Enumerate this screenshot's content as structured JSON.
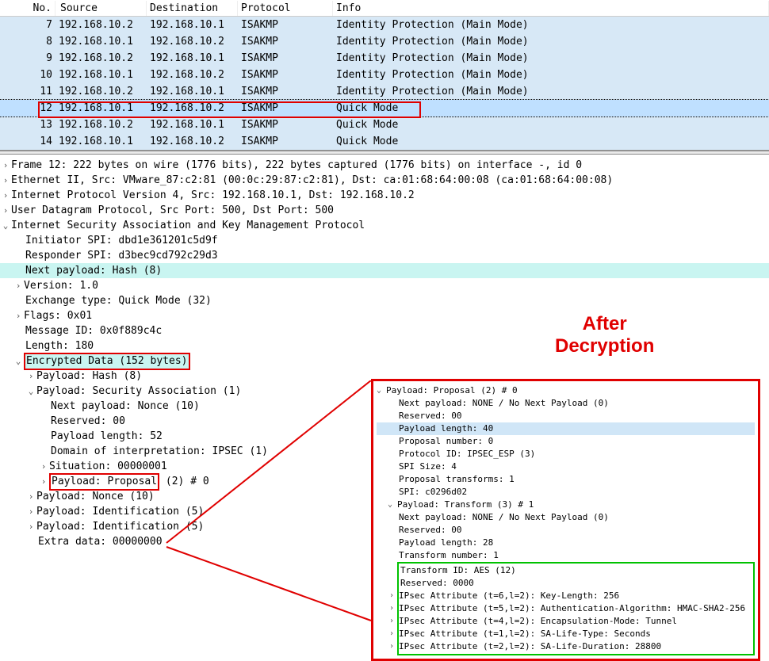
{
  "columns": {
    "no": "No.",
    "src": "Source",
    "dst": "Destination",
    "proto": "Protocol",
    "info": "Info"
  },
  "packets": [
    {
      "no": "7",
      "src": "192.168.10.2",
      "dst": "192.168.10.1",
      "proto": "ISAKMP",
      "info": "Identity Protection (Main Mode)",
      "cls": "row-lavender"
    },
    {
      "no": "8",
      "src": "192.168.10.1",
      "dst": "192.168.10.2",
      "proto": "ISAKMP",
      "info": "Identity Protection (Main Mode)",
      "cls": "row-lavender"
    },
    {
      "no": "9",
      "src": "192.168.10.2",
      "dst": "192.168.10.1",
      "proto": "ISAKMP",
      "info": "Identity Protection (Main Mode)",
      "cls": "row-lavender"
    },
    {
      "no": "10",
      "src": "192.168.10.1",
      "dst": "192.168.10.2",
      "proto": "ISAKMP",
      "info": "Identity Protection (Main Mode)",
      "cls": "row-lavender"
    },
    {
      "no": "11",
      "src": "192.168.10.2",
      "dst": "192.168.10.1",
      "proto": "ISAKMP",
      "info": "Identity Protection (Main Mode)",
      "cls": "row-lavender"
    },
    {
      "no": "12",
      "src": "192.168.10.1",
      "dst": "192.168.10.2",
      "proto": "ISAKMP",
      "info": "Quick Mode",
      "cls": "row-selected"
    },
    {
      "no": "13",
      "src": "192.168.10.2",
      "dst": "192.168.10.1",
      "proto": "ISAKMP",
      "info": "Quick Mode",
      "cls": "row-lavender"
    },
    {
      "no": "14",
      "src": "192.168.10.1",
      "dst": "192.168.10.2",
      "proto": "ISAKMP",
      "info": "Quick Mode",
      "cls": "row-lavender"
    }
  ],
  "details": {
    "frame": "Frame 12: 222 bytes on wire (1776 bits), 222 bytes captured (1776 bits) on interface -, id 0",
    "eth": "Ethernet II, Src: VMware_87:c2:81 (00:0c:29:87:c2:81), Dst: ca:01:68:64:00:08 (ca:01:68:64:00:08)",
    "ip": "Internet Protocol Version 4, Src: 192.168.10.1, Dst: 192.168.10.2",
    "udp": "User Datagram Protocol, Src Port: 500, Dst Port: 500",
    "isakmp": "Internet Security Association and Key Management Protocol",
    "initSPI": "Initiator SPI: dbd1e361201c5d9f",
    "respSPI": "Responder SPI: d3bec9cd792c29d3",
    "nextPayload": "Next payload: Hash (8)",
    "version": "Version: 1.0",
    "exchange": "Exchange type: Quick Mode (32)",
    "flags": "Flags: 0x01",
    "msgid": "Message ID: 0x0f889c4c",
    "length": "Length: 180",
    "encData": "Encrypted Data (152 bytes)",
    "plHash": "Payload: Hash (8)",
    "plSA": "Payload: Security Association (1)",
    "saNext": "Next payload: Nonce (10)",
    "saReserved": "Reserved: 00",
    "saLen": "Payload length: 52",
    "saDOI": "Domain of interpretation: IPSEC (1)",
    "saSit": "Situation: 00000001",
    "plProposalPrefix": "Payload: Proposal",
    "plProposalSuffix": " (2) # 0",
    "plNonce": "Payload: Nonce (10)",
    "plId1": "Payload: Identification (5)",
    "plId2": "Payload: Identification (5)",
    "extra": "Extra data: 00000000"
  },
  "decryptTitle1": "After",
  "decryptTitle2": "Decryption",
  "decrypt": {
    "prop": "Payload: Proposal (2) # 0",
    "propNext": "Next payload: NONE / No Next Payload  (0)",
    "propRes": "Reserved: 00",
    "propLen": "Payload length: 40",
    "propNum": "Proposal number: 0",
    "protoID": "Protocol ID: IPSEC_ESP (3)",
    "spiSize": "SPI Size: 4",
    "propTrans": "Proposal transforms: 1",
    "spi": "SPI: c0296d02",
    "trans": "Payload: Transform (3) # 1",
    "transNext": "Next payload: NONE / No Next Payload  (0)",
    "transRes": "Reserved: 00",
    "transLen": "Payload length: 28",
    "transNum": "Transform number: 1",
    "transID": "Transform ID: AES (12)",
    "transRes2": "Reserved: 0000",
    "attr1": "IPsec Attribute (t=6,l=2): Key-Length: 256",
    "attr2": "IPsec Attribute (t=5,l=2): Authentication-Algorithm: HMAC-SHA2-256",
    "attr3": "IPsec Attribute (t=4,l=2): Encapsulation-Mode: Tunnel",
    "attr4": "IPsec Attribute (t=1,l=2): SA-Life-Type: Seconds",
    "attr5": "IPsec Attribute (t=2,l=2): SA-Life-Duration: 28800"
  }
}
